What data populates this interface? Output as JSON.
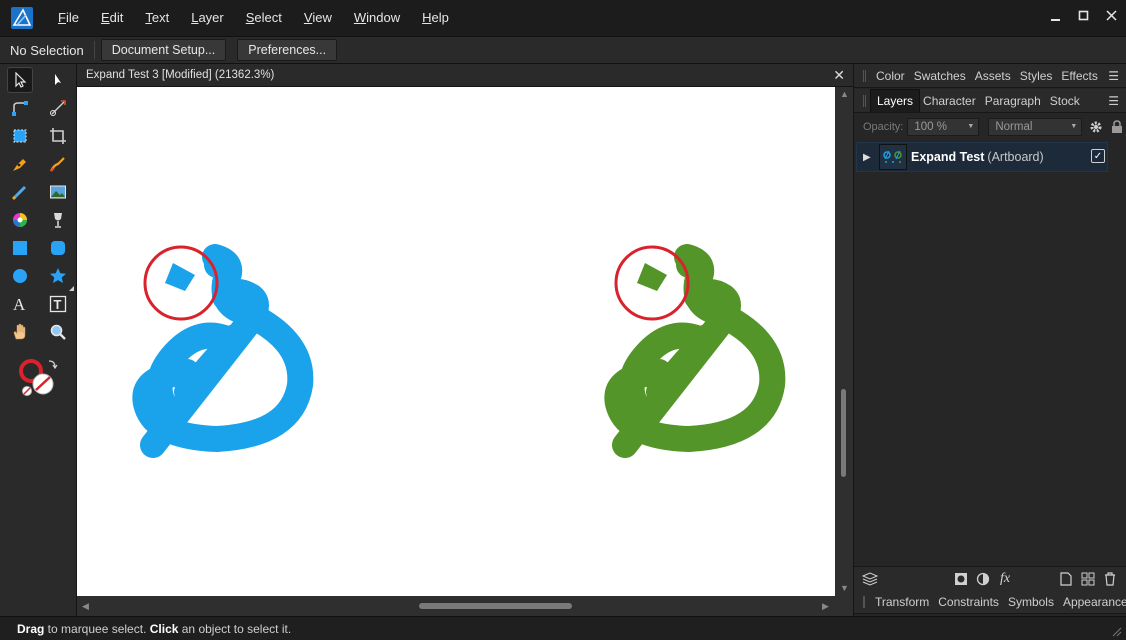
{
  "menubar": {
    "items": [
      {
        "label": "File",
        "accel": "F",
        "rest": "ile"
      },
      {
        "label": "Edit",
        "accel": "E",
        "rest": "dit"
      },
      {
        "label": "Text",
        "accel": "T",
        "rest": "ext"
      },
      {
        "label": "Layer",
        "accel": "L",
        "rest": "ayer"
      },
      {
        "label": "Select",
        "accel": "S",
        "rest": "elect"
      },
      {
        "label": "View",
        "accel": "V",
        "rest": "iew"
      },
      {
        "label": "Window",
        "accel": "W",
        "rest": "indow"
      },
      {
        "label": "Help",
        "accel": "H",
        "rest": "elp"
      }
    ]
  },
  "context": {
    "selection": "No Selection",
    "document_setup": "Document Setup...",
    "preferences": "Preferences..."
  },
  "document": {
    "tab_title": "Expand Test 3 [Modified] (21362.3%)",
    "close": "✕"
  },
  "panels": {
    "top_tabs": [
      "Color",
      "Swatches",
      "Assets",
      "Styles",
      "Effects"
    ],
    "layer_tabs": [
      "Layers",
      "Character",
      "Paragraph",
      "Stock"
    ],
    "opacity_label": "Opacity:",
    "opacity_value": "100 %",
    "blend_mode": "Normal",
    "layer": {
      "name": "Expand Test",
      "kind": "(Artboard)",
      "visible": true
    },
    "bottom_tabs": [
      "Transform",
      "Constraints",
      "Symbols",
      "Appearance"
    ]
  },
  "status": {
    "drag": "Drag",
    "drag_text": " to marquee select. ",
    "click": "Click",
    "click_text": " an object to select it."
  },
  "colors": {
    "blue_shape": "#1aa3ea",
    "green_shape": "#54952a",
    "highlight_circle": "#d8232c",
    "accent": "#2a78c8"
  }
}
